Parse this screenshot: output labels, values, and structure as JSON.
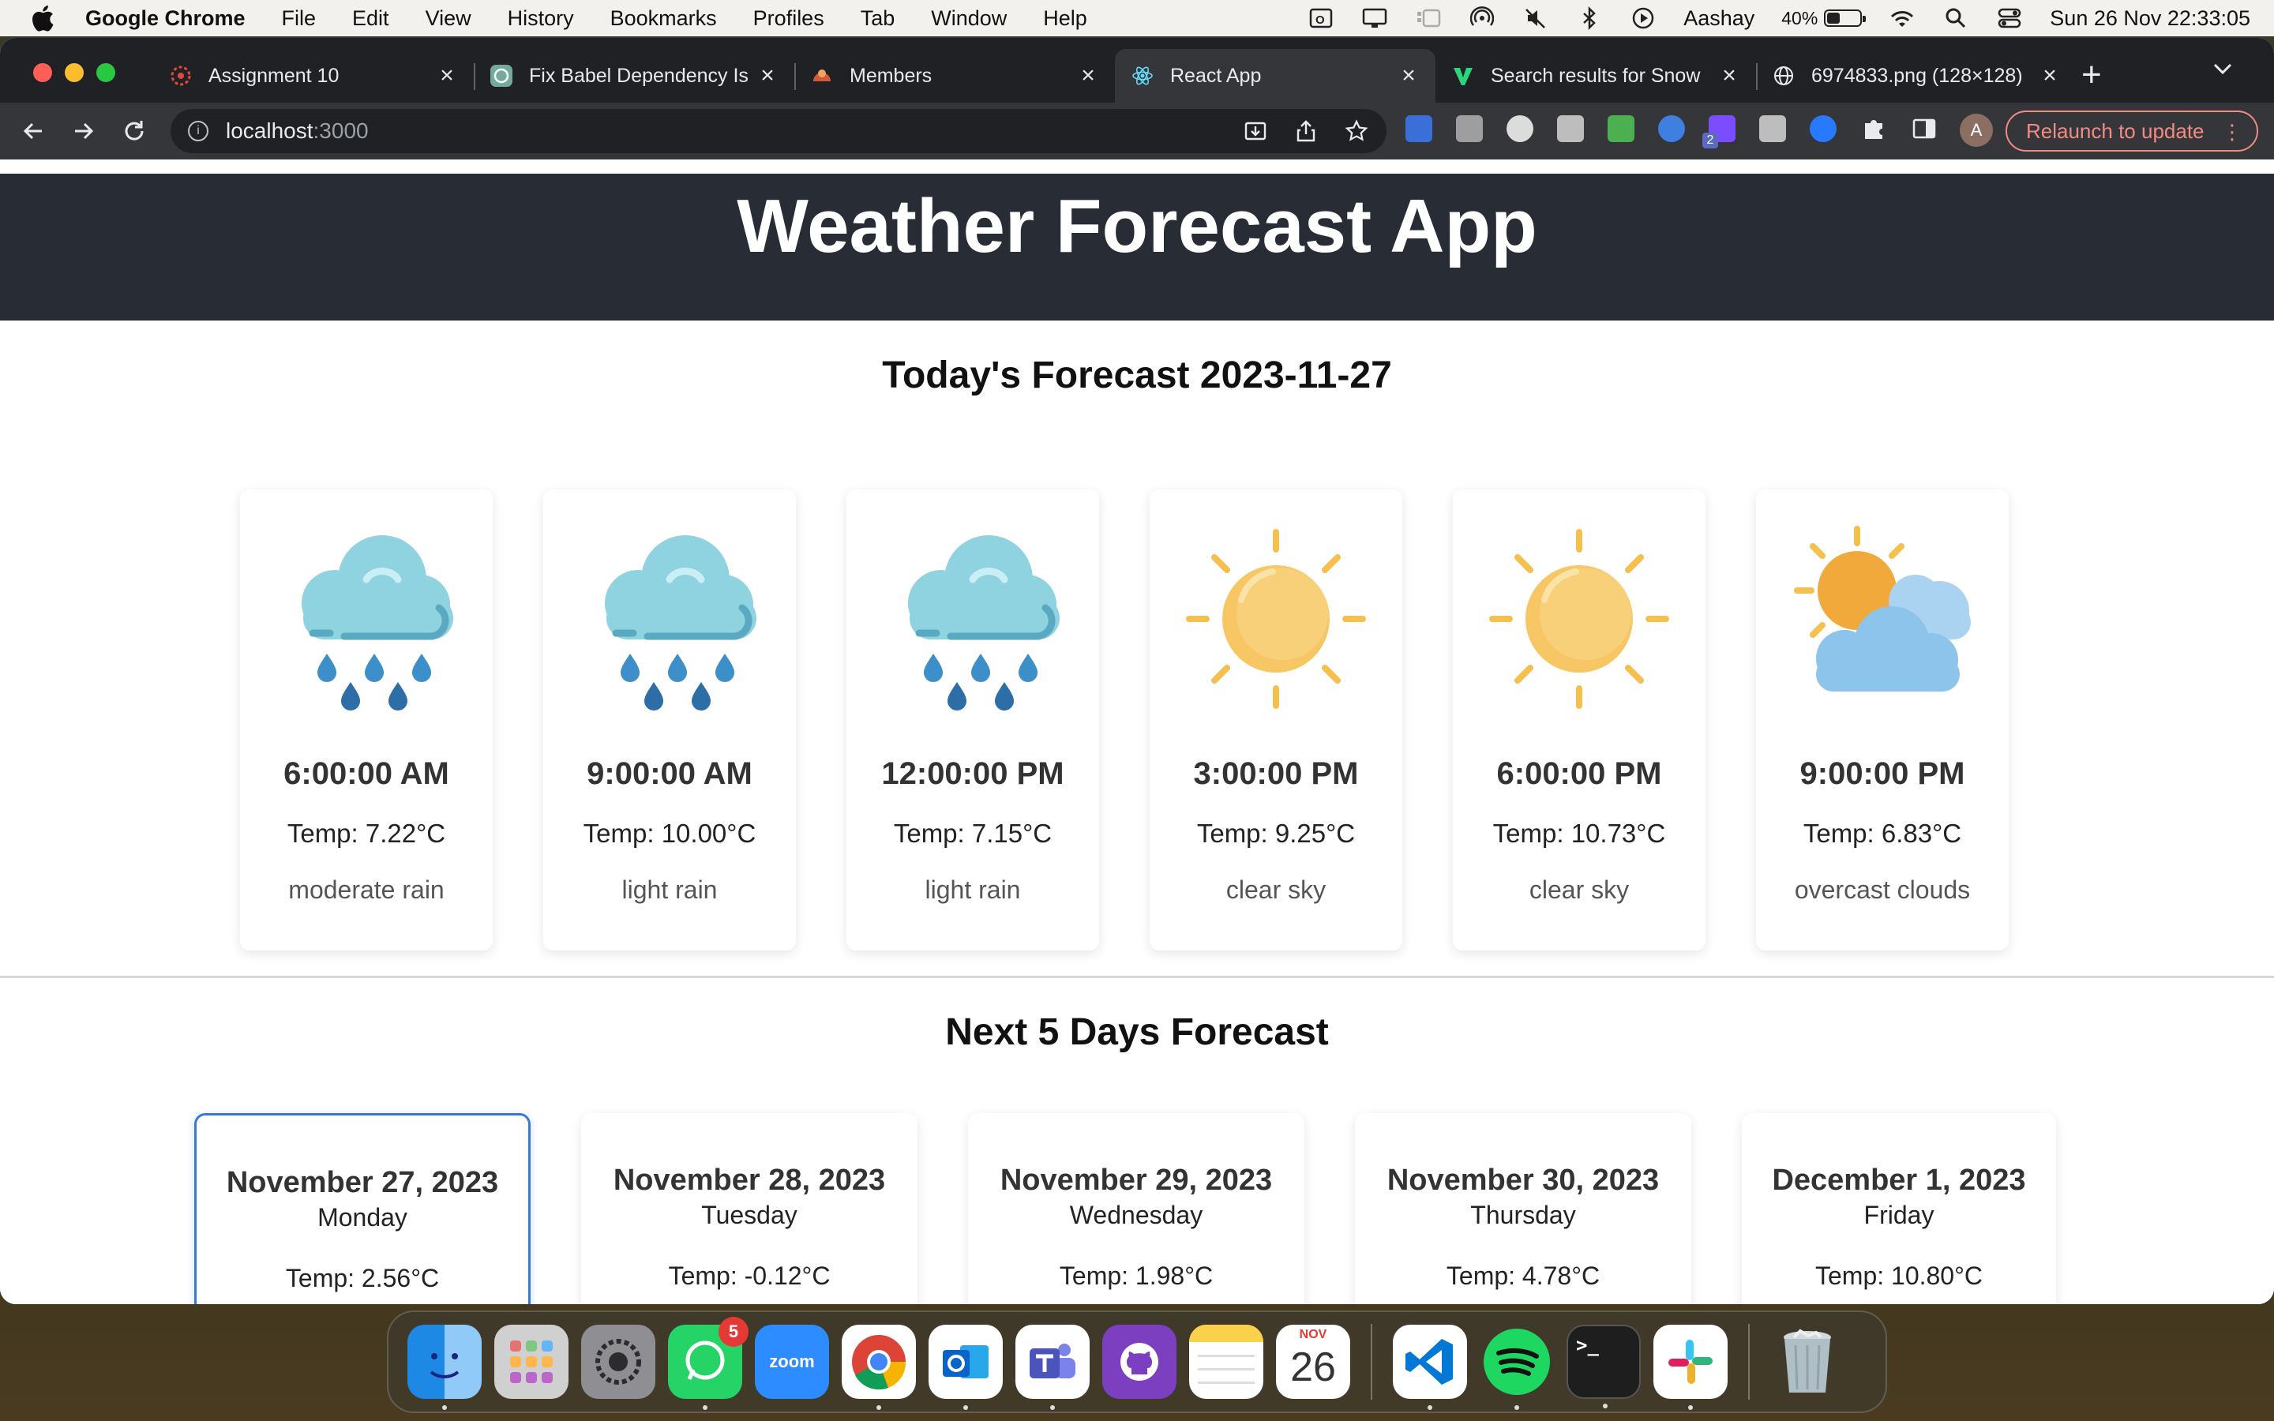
{
  "menubar": {
    "app_name": "Google Chrome",
    "menus": [
      "File",
      "Edit",
      "View",
      "History",
      "Bookmarks",
      "Profiles",
      "Tab",
      "Window",
      "Help"
    ],
    "user": "Aashay",
    "battery_percent": "40%",
    "battery_level": 0.4,
    "datetime": "Sun 26 Nov  22:33:05"
  },
  "browser": {
    "tabs": [
      {
        "title": "Assignment 10",
        "icon": "canvas-icon"
      },
      {
        "title": "Fix Babel Dependency Is",
        "icon": "chatgpt-icon"
      },
      {
        "title": "Members",
        "icon": "members-icon"
      },
      {
        "title": "React App",
        "icon": "react-icon",
        "active": true
      },
      {
        "title": "Search results for Snow",
        "icon": "vectorportal-icon"
      },
      {
        "title": "6974833.png (128×128)",
        "icon": "globe-icon"
      }
    ],
    "url_host": "localhost",
    "url_port": ":3000",
    "relaunch_label": "Relaunch to update",
    "avatar_letter": "A",
    "extension_badge": "2"
  },
  "app": {
    "title": "Weather Forecast App",
    "today_heading": "Today's Forecast 2023-11-27",
    "hourly": [
      {
        "time": "6:00:00 AM",
        "temp": "Temp: 7.22°C",
        "description": "moderate rain",
        "icon": "rain-cloud-icon"
      },
      {
        "time": "9:00:00 AM",
        "temp": "Temp: 10.00°C",
        "description": "light rain",
        "icon": "rain-cloud-icon"
      },
      {
        "time": "12:00:00 PM",
        "temp": "Temp: 7.15°C",
        "description": "light rain",
        "icon": "rain-cloud-icon"
      },
      {
        "time": "3:00:00 PM",
        "temp": "Temp: 9.25°C",
        "description": "clear sky",
        "icon": "sun-icon"
      },
      {
        "time": "6:00:00 PM",
        "temp": "Temp: 10.73°C",
        "description": "clear sky",
        "icon": "sun-icon"
      },
      {
        "time": "9:00:00 PM",
        "temp": "Temp: 6.83°C",
        "description": "overcast clouds",
        "icon": "sun-cloud-icon"
      }
    ],
    "days_heading": "Next 5 Days Forecast",
    "daily": [
      {
        "date": "November 27, 2023",
        "weekday": "Monday",
        "temp": "Temp: 2.56°C",
        "selected": true
      },
      {
        "date": "November 28, 2023",
        "weekday": "Tuesday",
        "temp": "Temp: -0.12°C"
      },
      {
        "date": "November 29, 2023",
        "weekday": "Wednesday",
        "temp": "Temp: 1.98°C"
      },
      {
        "date": "November 30, 2023",
        "weekday": "Thursday",
        "temp": "Temp: 4.78°C"
      },
      {
        "date": "December 1, 2023",
        "weekday": "Friday",
        "temp": "Temp: 10.80°C"
      }
    ]
  },
  "dock": {
    "whatsapp_badge": "5",
    "zoom_label": "zoom",
    "calendar_month": "NOV",
    "calendar_day": "26",
    "terminal_prompt": ">_"
  },
  "colors": {
    "header_bg": "#282c34",
    "selected_border": "#3a78d6",
    "relaunch": "#f28b82"
  }
}
